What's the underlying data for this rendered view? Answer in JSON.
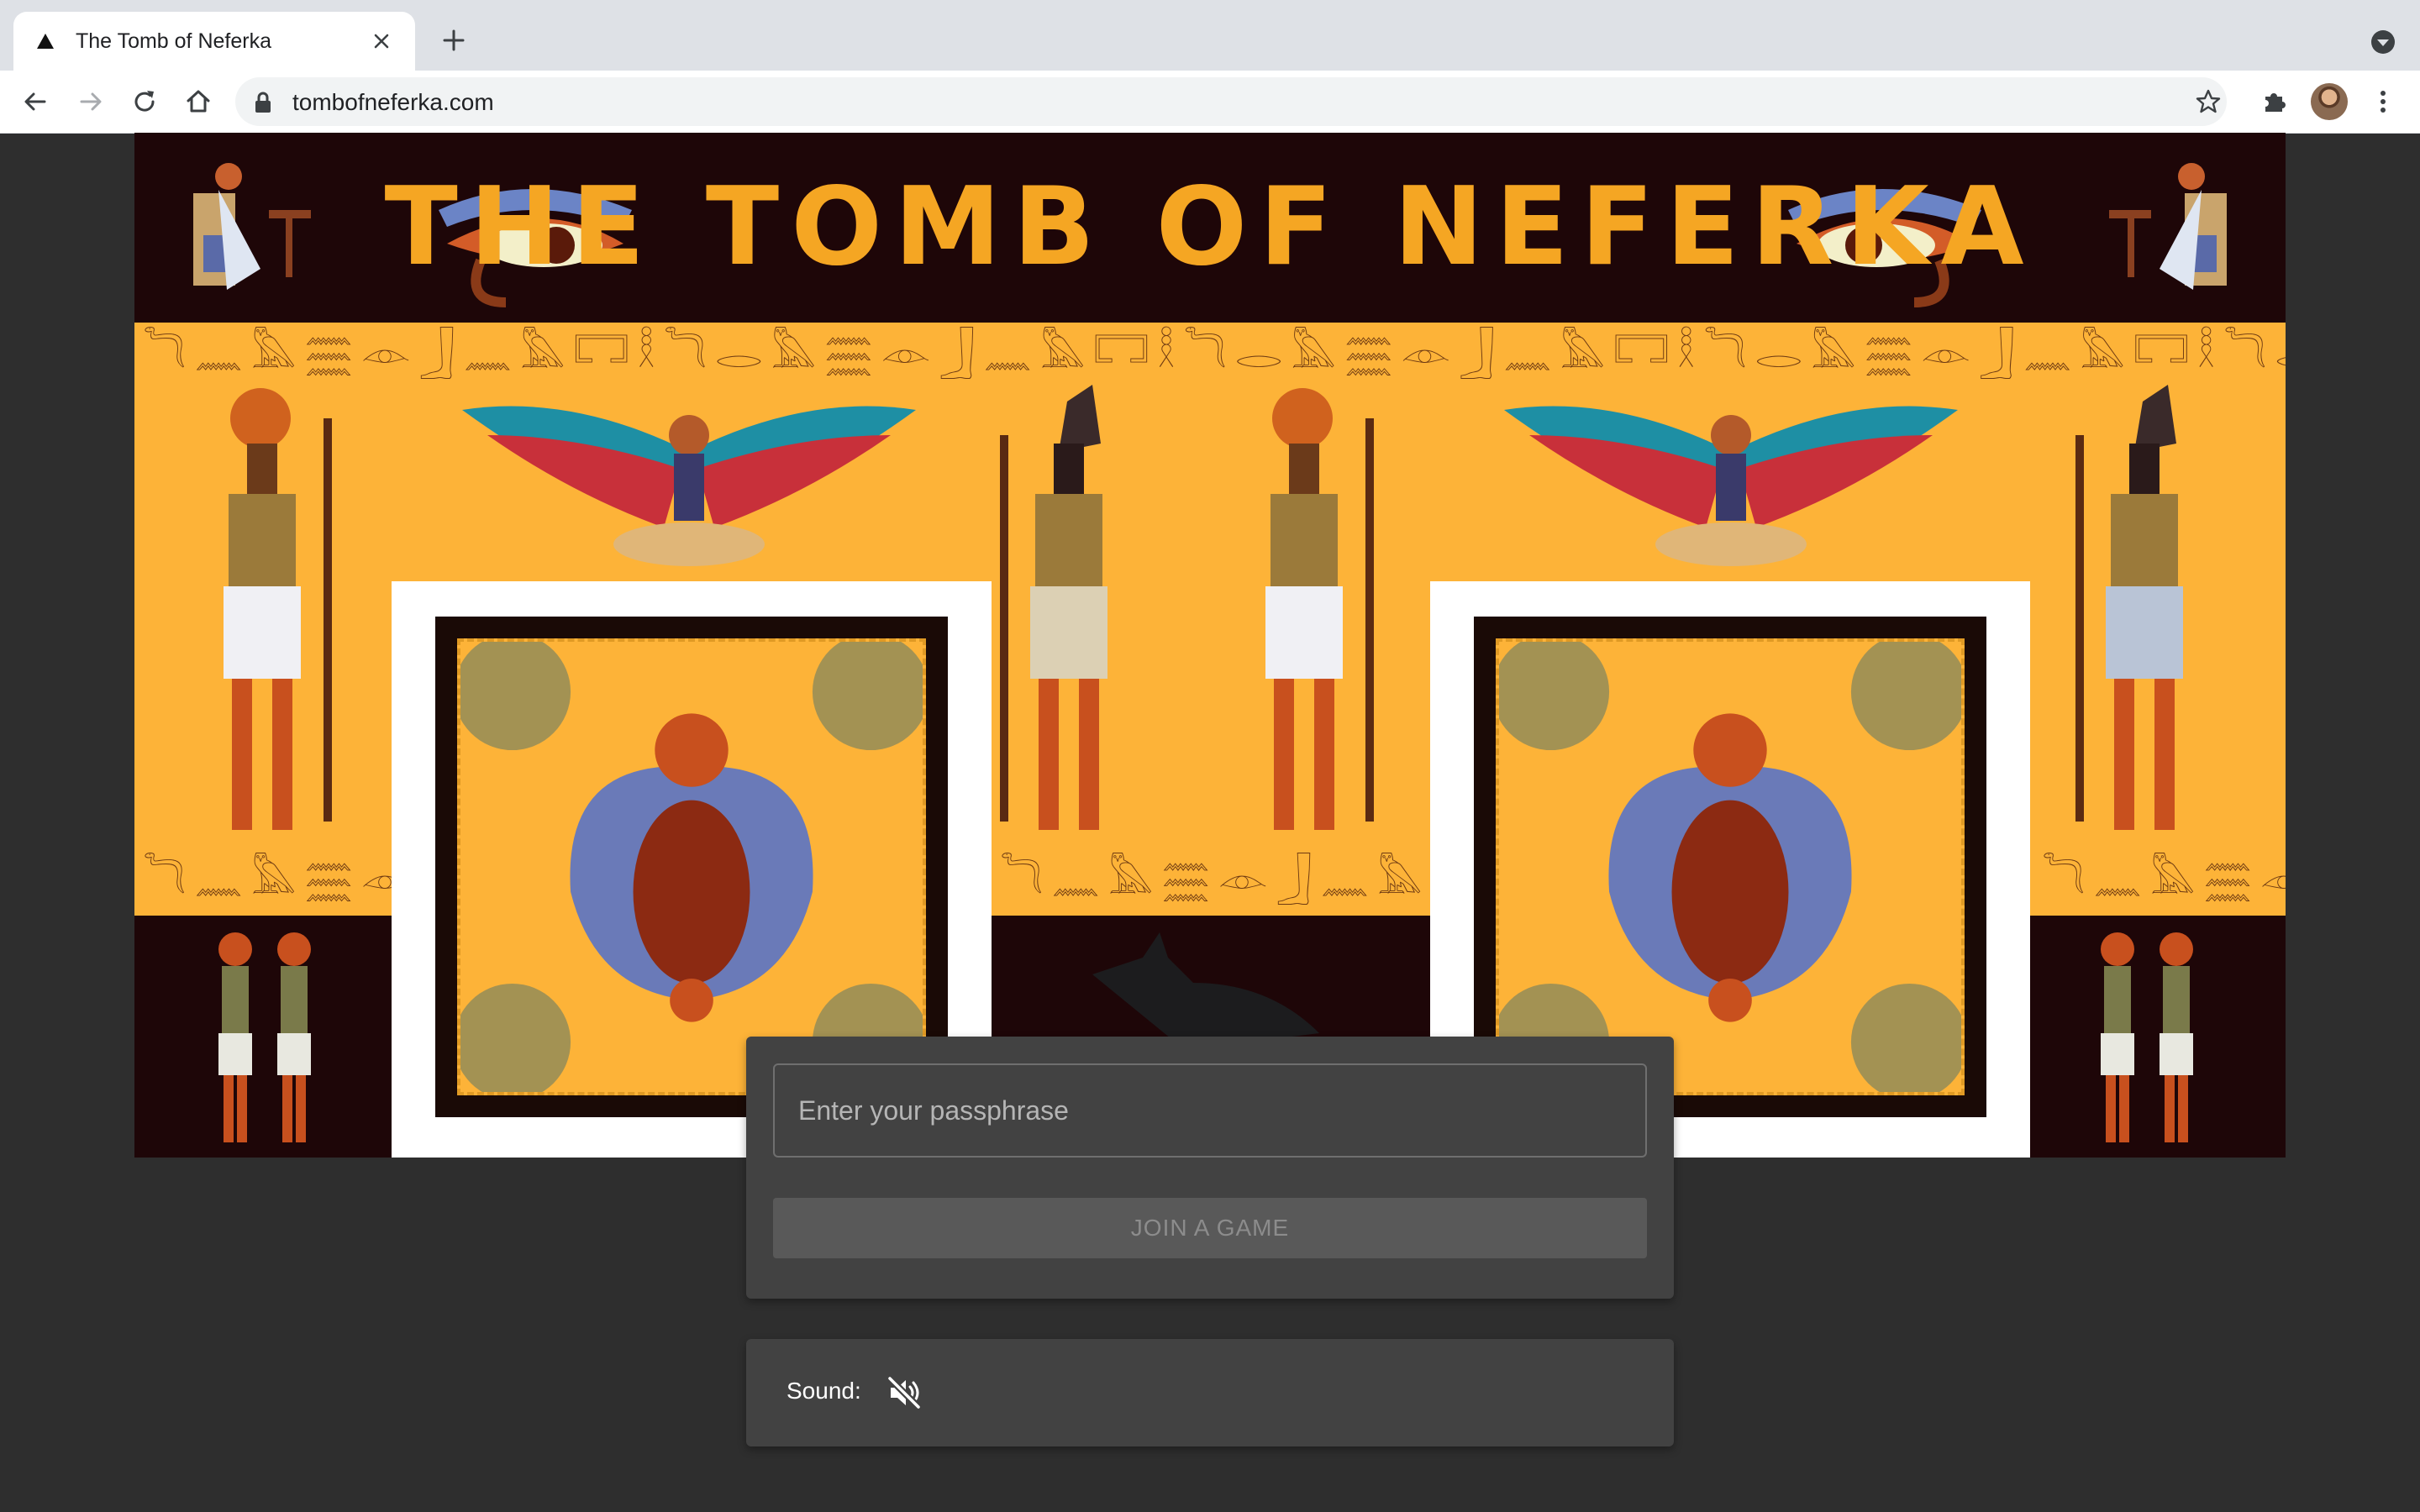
{
  "browser": {
    "tab_title": "The Tomb of Neferka",
    "url": "tombofneferka.com",
    "icons": [
      "triangle-favicon-icon",
      "close-icon",
      "plus-icon",
      "tab-search-icon",
      "back-arrow-icon",
      "forward-arrow-icon",
      "reload-icon",
      "home-icon",
      "lock-icon",
      "star-icon",
      "puzzle-extension-icon",
      "profile-avatar",
      "kebab-menu-icon"
    ]
  },
  "game": {
    "title": "THE TOMB OF NEFERKA",
    "passphrase_placeholder": "Enter your passphrase",
    "passphrase_value": "",
    "join_label": "JOIN A GAME",
    "sound_label": "Sound:",
    "sound_state": "muted"
  },
  "colors": {
    "page_bg": "#2e2e2e",
    "banner_gold": "#fdb338",
    "banner_dark": "#1e0608",
    "title_gold": "#f5a623",
    "card_bg": "#424242",
    "button_disabled": "#595959"
  }
}
